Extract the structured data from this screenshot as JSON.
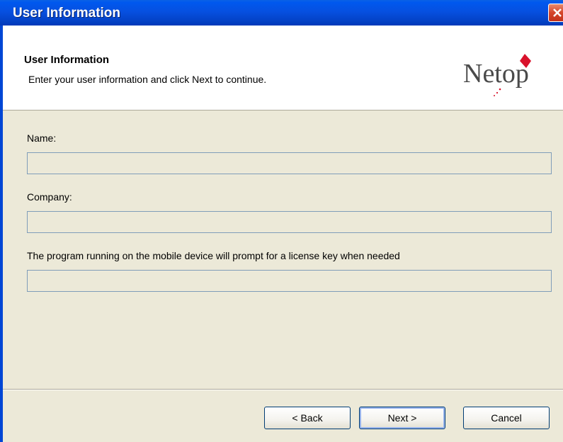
{
  "window": {
    "title": "User Information"
  },
  "header": {
    "title": "User Information",
    "subtitle": "Enter your user information and click Next to continue.",
    "logo_text": "Netop"
  },
  "form": {
    "name_label": "Name:",
    "name_value": "",
    "company_label": "Company:",
    "company_value": "",
    "license_label": "The program running on the mobile device will prompt for a license key when needed",
    "license_value": ""
  },
  "buttons": {
    "back": "< Back",
    "next": "Next >",
    "cancel": "Cancel"
  },
  "colors": {
    "titlebar": "#0058ee",
    "dialog_bg": "#ece9d8",
    "logo_red": "#d9122b"
  },
  "icons": {
    "close": "close-icon"
  }
}
